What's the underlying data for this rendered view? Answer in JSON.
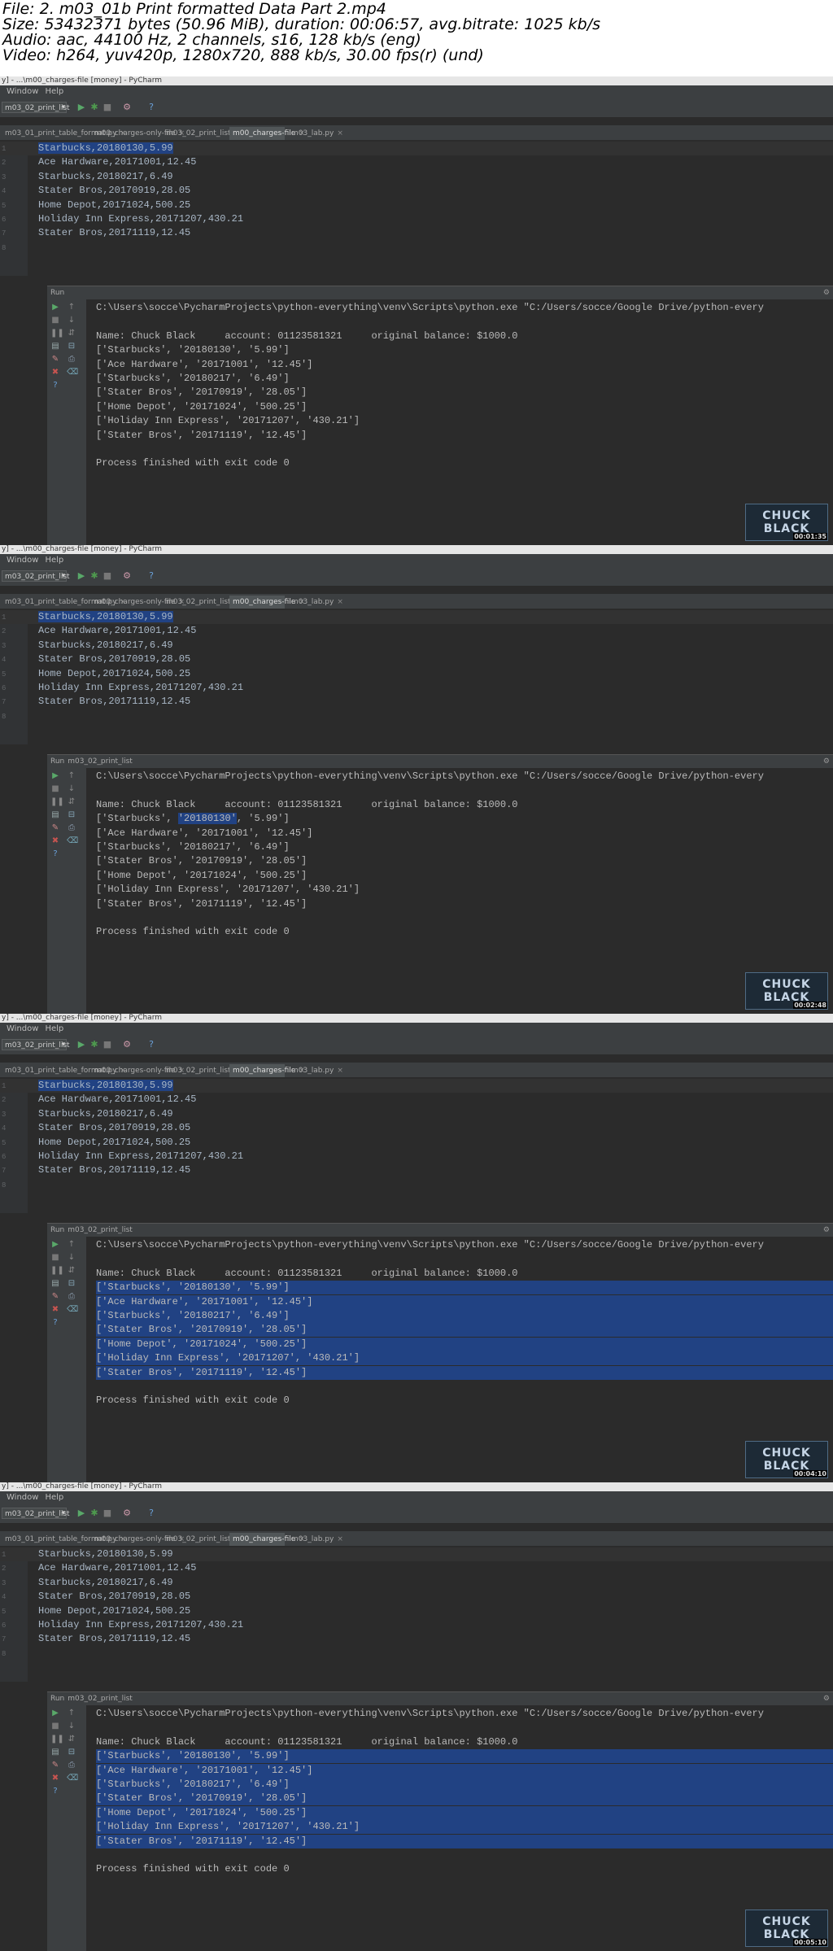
{
  "header": {
    "line1": "File: 2. m03_01b Print formatted Data Part 2.mp4",
    "line2": "Size: 53432371 bytes (50.96 MiB), duration: 00:06:57, avg.bitrate: 1025 kb/s",
    "line3": "Audio: aac, 44100 Hz, 2 channels, s16, 128 kb/s (eng)",
    "line4": "Video: h264, yuv420p, 1280x720, 888 kb/s, 30.00 fps(r) (und)"
  },
  "frames": [
    {
      "title": "y] - ...\\m00_charges-file [money] - PyCharm",
      "menu": [
        "Window",
        "Help"
      ],
      "run_config": "m03_02_print_list",
      "tabs": [
        "m03_01_print_table_format.py",
        "m00_charges-only-file",
        "m03_02_print_list.py",
        "m00_charges-file",
        "m03_lab.py"
      ],
      "active_tab": 3,
      "editor_lines": [
        {
          "ln": "1",
          "pre": "",
          "sel": "Starbucks,20180130,5.99",
          "post": ""
        },
        {
          "ln": "2",
          "pre": "Ace Hardware,20171001,12.45",
          "sel": "",
          "post": ""
        },
        {
          "ln": "3",
          "pre": "Starbucks,20180217,6.49",
          "sel": "",
          "post": ""
        },
        {
          "ln": "4",
          "pre": "Stater Bros,20170919,28.05",
          "sel": "",
          "post": ""
        },
        {
          "ln": "5",
          "pre": "Home Depot,20171024,500.25",
          "sel": "",
          "post": ""
        },
        {
          "ln": "6",
          "pre": "Holiday Inn Express,20171207,430.21",
          "sel": "",
          "post": ""
        },
        {
          "ln": "7",
          "pre": "Stater Bros,20171119,12.45",
          "sel": "",
          "post": ""
        },
        {
          "ln": "8",
          "pre": "",
          "sel": "",
          "post": ""
        }
      ],
      "run_label": "Run",
      "run_title": "",
      "console": [
        {
          "pre": "C:\\Users\\socce\\PycharmProjects\\python-everything\\venv\\Scripts\\python.exe \"C:/Users/socce/Google Drive/python-every",
          "sel": "",
          "post": "",
          "hl": false
        },
        {
          "pre": "",
          "sel": "",
          "post": "",
          "hl": false
        },
        {
          "pre": "Name: Chuck Black     account: 01123581321     original balance: $1000.0",
          "sel": "",
          "post": "",
          "hl": false
        },
        {
          "pre": "['Starbucks', '20180130', '5.99']",
          "sel": "",
          "post": "",
          "hl": false
        },
        {
          "pre": "['Ace Hardware', '20171001', '12.45']",
          "sel": "",
          "post": "",
          "hl": false
        },
        {
          "pre": "['Starbucks', '20180217', '6.49']",
          "sel": "",
          "post": "",
          "hl": false
        },
        {
          "pre": "['Stater Bros', '20170919', '28.05']",
          "sel": "",
          "post": "",
          "hl": false
        },
        {
          "pre": "['Home Depot', '20171024', '500.25']",
          "sel": "",
          "post": "",
          "hl": false
        },
        {
          "pre": "['Holiday Inn Express', '20171207', '430.21']",
          "sel": "",
          "post": "",
          "hl": false
        },
        {
          "pre": "['Stater Bros', '20171119', '12.45']",
          "sel": "",
          "post": "",
          "hl": false
        },
        {
          "pre": "",
          "sel": "",
          "post": "",
          "hl": false
        },
        {
          "pre": "Process finished with exit code 0",
          "sel": "",
          "post": "",
          "hl": false
        }
      ],
      "watermark": [
        "CHUCK",
        "BLACK"
      ],
      "timestamp": "00:01:35"
    },
    {
      "title": "y] - ...\\m00_charges-file [money] - PyCharm",
      "menu": [
        "Window",
        "Help"
      ],
      "run_config": "m03_02_print_list",
      "tabs": [
        "m03_01_print_table_format.py",
        "m00_charges-only-file",
        "m03_02_print_list.py",
        "m00_charges-file",
        "m03_lab.py"
      ],
      "active_tab": 3,
      "editor_lines": [
        {
          "ln": "1",
          "pre": "",
          "sel": "Starbucks,20180130,5.99",
          "post": ""
        },
        {
          "ln": "2",
          "pre": "Ace Hardware,20171001,12.45",
          "sel": "",
          "post": ""
        },
        {
          "ln": "3",
          "pre": "Starbucks,20180217,6.49",
          "sel": "",
          "post": ""
        },
        {
          "ln": "4",
          "pre": "Stater Bros,20170919,28.05",
          "sel": "",
          "post": ""
        },
        {
          "ln": "5",
          "pre": "Home Depot,20171024,500.25",
          "sel": "",
          "post": ""
        },
        {
          "ln": "6",
          "pre": "Holiday Inn Express,20171207,430.21",
          "sel": "",
          "post": ""
        },
        {
          "ln": "7",
          "pre": "Stater Bros,20171119,12.45",
          "sel": "",
          "post": ""
        },
        {
          "ln": "8",
          "pre": "",
          "sel": "",
          "post": ""
        }
      ],
      "run_label": "Run",
      "run_title": "m03_02_print_list",
      "console": [
        {
          "pre": "C:\\Users\\socce\\PycharmProjects\\python-everything\\venv\\Scripts\\python.exe \"C:/Users/socce/Google Drive/python-every",
          "sel": "",
          "post": "",
          "hl": false
        },
        {
          "pre": "",
          "sel": "",
          "post": "",
          "hl": false
        },
        {
          "pre": "Name: Chuck Black     account: 01123581321     original balance: $1000.0",
          "sel": "",
          "post": "",
          "hl": false
        },
        {
          "pre": "['Starbucks', ",
          "sel": "'20180130'",
          "post": ", '5.99']",
          "hl": false
        },
        {
          "pre": "['Ace Hardware', '20171001', '12.45']",
          "sel": "",
          "post": "",
          "hl": false
        },
        {
          "pre": "['Starbucks', '20180217', '6.49']",
          "sel": "",
          "post": "",
          "hl": false
        },
        {
          "pre": "['Stater Bros', '20170919', '28.05']",
          "sel": "",
          "post": "",
          "hl": false
        },
        {
          "pre": "['Home Depot', '20171024', '500.25']",
          "sel": "",
          "post": "",
          "hl": false
        },
        {
          "pre": "['Holiday Inn Express', '20171207', '430.21']",
          "sel": "",
          "post": "",
          "hl": false
        },
        {
          "pre": "['Stater Bros', '20171119', '12.45']",
          "sel": "",
          "post": "",
          "hl": false
        },
        {
          "pre": "",
          "sel": "",
          "post": "",
          "hl": false
        },
        {
          "pre": "Process finished with exit code 0",
          "sel": "",
          "post": "",
          "hl": false
        }
      ],
      "watermark": [
        "CHUCK",
        "BLACK"
      ],
      "timestamp": "00:02:48"
    },
    {
      "title": "y] - ...\\m00_charges-file [money] - PyCharm",
      "menu": [
        "Window",
        "Help"
      ],
      "run_config": "m03_02_print_list",
      "tabs": [
        "m03_01_print_table_format.py",
        "m00_charges-only-file",
        "m03_02_print_list.py",
        "m00_charges-file",
        "m03_lab.py"
      ],
      "active_tab": 3,
      "editor_lines": [
        {
          "ln": "1",
          "pre": "",
          "sel": "Starbucks,20180130,5.99",
          "post": ""
        },
        {
          "ln": "2",
          "pre": "Ace Hardware,20171001,12.45",
          "sel": "",
          "post": ""
        },
        {
          "ln": "3",
          "pre": "Starbucks,20180217,6.49",
          "sel": "",
          "post": ""
        },
        {
          "ln": "4",
          "pre": "Stater Bros,20170919,28.05",
          "sel": "",
          "post": ""
        },
        {
          "ln": "5",
          "pre": "Home Depot,20171024,500.25",
          "sel": "",
          "post": ""
        },
        {
          "ln": "6",
          "pre": "Holiday Inn Express,20171207,430.21",
          "sel": "",
          "post": ""
        },
        {
          "ln": "7",
          "pre": "Stater Bros,20171119,12.45",
          "sel": "",
          "post": ""
        },
        {
          "ln": "8",
          "pre": "",
          "sel": "",
          "post": ""
        }
      ],
      "run_label": "Run",
      "run_title": "m03_02_print_list",
      "console": [
        {
          "pre": "C:\\Users\\socce\\PycharmProjects\\python-everything\\venv\\Scripts\\python.exe \"C:/Users/socce/Google Drive/python-every",
          "sel": "",
          "post": "",
          "hl": false
        },
        {
          "pre": "",
          "sel": "",
          "post": "",
          "hl": false
        },
        {
          "pre": "Name: Chuck Black     account: 01123581321     original balance: $1000.0",
          "sel": "",
          "post": "",
          "hl": false
        },
        {
          "pre": "['Starbucks', '20180130', '5.99']",
          "sel": "",
          "post": "",
          "hl": true
        },
        {
          "pre": "['Ace Hardware', '20171001', '12.45']",
          "sel": "",
          "post": "",
          "hl": true
        },
        {
          "pre": "['Starbucks', '20180217', '6.49']",
          "sel": "",
          "post": "",
          "hl": true
        },
        {
          "pre": "['Stater Bros', '20170919', '28.05']",
          "sel": "",
          "post": "",
          "hl": true
        },
        {
          "pre": "['Home Depot', '20171024', '500.25']",
          "sel": "",
          "post": "",
          "hl": true
        },
        {
          "pre": "['Holiday Inn Express', '20171207', '430.21']",
          "sel": "",
          "post": "",
          "hl": true
        },
        {
          "pre": "['Stater Bros', '20171119', '12.45']",
          "sel": "",
          "post": "",
          "hl": true
        },
        {
          "pre": "",
          "sel": "",
          "post": "",
          "hl": false
        },
        {
          "pre": "Process finished with exit code 0",
          "sel": "",
          "post": "",
          "hl": false
        }
      ],
      "watermark": [
        "CHUCK",
        "BLACK"
      ],
      "timestamp": "00:04:10"
    },
    {
      "title": "y] - ...\\m00_charges-file [money] - PyCharm",
      "menu": [
        "Window",
        "Help"
      ],
      "run_config": "m03_02_print_list",
      "tabs": [
        "m03_01_print_table_format.py",
        "m00_charges-only-file",
        "m03_02_print_list.py",
        "m00_charges-file",
        "m03_lab.py"
      ],
      "active_tab": 3,
      "editor_lines": [
        {
          "ln": "1",
          "pre": "Starbucks,20180130,5.99",
          "sel": "",
          "post": ""
        },
        {
          "ln": "2",
          "pre": "Ace Hardware,20171001,12.45",
          "sel": "",
          "post": ""
        },
        {
          "ln": "3",
          "pre": "Starbucks,20180217,6.49",
          "sel": "",
          "post": ""
        },
        {
          "ln": "4",
          "pre": "Stater Bros,20170919,28.05",
          "sel": "",
          "post": ""
        },
        {
          "ln": "5",
          "pre": "Home Depot,20171024,500.25",
          "sel": "",
          "post": ""
        },
        {
          "ln": "6",
          "pre": "Holiday Inn Express,20171207,430.21",
          "sel": "",
          "post": ""
        },
        {
          "ln": "7",
          "pre": "Stater Bros,20171119,12.45",
          "sel": "",
          "post": ""
        },
        {
          "ln": "8",
          "pre": "",
          "sel": "",
          "post": ""
        }
      ],
      "run_label": "Run",
      "run_title": "m03_02_print_list",
      "console": [
        {
          "pre": "C:\\Users\\socce\\PycharmProjects\\python-everything\\venv\\Scripts\\python.exe \"C:/Users/socce/Google Drive/python-every",
          "sel": "",
          "post": "",
          "hl": false
        },
        {
          "pre": "",
          "sel": "",
          "post": "",
          "hl": false
        },
        {
          "pre": "Name: Chuck Black     account: 01123581321     original balance: $1000.0",
          "sel": "",
          "post": "",
          "hl": false
        },
        {
          "pre": "['Starbucks', '20180130', '5.99']",
          "sel": "",
          "post": "",
          "hl": true
        },
        {
          "pre": "['Ace Hardware', '20171001', '12.45']",
          "sel": "",
          "post": "",
          "hl": true
        },
        {
          "pre": "['Starbucks', '20180217', '6.49']",
          "sel": "",
          "post": "",
          "hl": true
        },
        {
          "pre": "['Stater Bros', '20170919', '28.05']",
          "sel": "",
          "post": "",
          "hl": true
        },
        {
          "pre": "['Home Depot', '20171024', '500.25']",
          "sel": "",
          "post": "",
          "hl": true
        },
        {
          "pre": "['Holiday Inn Express', '20171207', '430.21']",
          "sel": "",
          "post": "",
          "hl": true
        },
        {
          "pre": "['Stater Bros', '20171119', '12.45']",
          "sel": "",
          "post": "",
          "hl": true
        },
        {
          "pre": "",
          "sel": "",
          "post": "",
          "hl": false
        },
        {
          "pre": "Process finished with exit code 0",
          "sel": "",
          "post": "",
          "hl": false
        }
      ],
      "watermark": [
        "CHUCK",
        "BLACK"
      ],
      "timestamp": "00:05:10"
    }
  ],
  "colors": {
    "editor_bg": "#2b2b2b",
    "panel_bg": "#3c3f41",
    "selection": "#214283",
    "code_text": "#a9b7c6",
    "console_text": "#bbbbbb",
    "run_green": "#59a869",
    "debug_green": "#4e9a4e",
    "stop_red": "#c75450"
  },
  "icons": {
    "run": "run-triangle-icon",
    "debug": "debug-bug-icon",
    "stop": "stop-square-icon",
    "settings": "gear-icon",
    "help": "help-question-icon"
  }
}
